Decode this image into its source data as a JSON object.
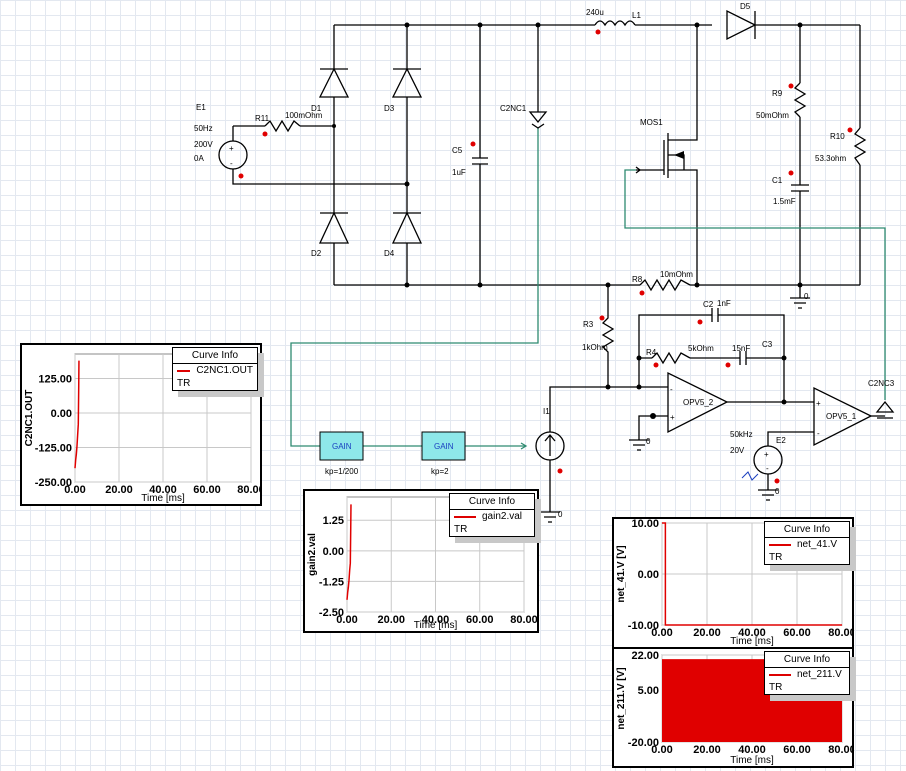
{
  "schematic": {
    "E1": {
      "name": "E1",
      "freq": "50Hz",
      "amp": "200V",
      "phase": "0A"
    },
    "R11": {
      "name": "R11",
      "value": "100mOhm"
    },
    "D1": "D1",
    "D2": "D2",
    "D3": "D3",
    "D4": "D4",
    "D5": "D5",
    "C5": {
      "name": "C5",
      "value": "1uF"
    },
    "C2NC1": {
      "name": "C2NC1"
    },
    "L1": {
      "name": "L1",
      "value": "240u"
    },
    "MOS1": {
      "name": "MOS1"
    },
    "R9": {
      "name": "R9",
      "value": "50mOhm"
    },
    "R10": {
      "name": "R10",
      "value": "53.3ohm"
    },
    "C1": {
      "name": "C1",
      "value": "1.5mF"
    },
    "R8": {
      "name": "R8",
      "value": "10mOhm"
    },
    "ground_label": "0",
    "R3": {
      "name": "R3",
      "value": "1kOhm"
    },
    "C2": {
      "name": "C2",
      "value": "1nF"
    },
    "R4": {
      "name": "R4",
      "value": "5kOhm"
    },
    "C3": {
      "name": "C3",
      "value": "15nF"
    },
    "OPV5_2": "OPV5_2",
    "OPV5_1": "OPV5_1",
    "C2NC3": "C2NC3",
    "E2": {
      "name": "E2",
      "freq": "50kHz",
      "amp": "20V"
    },
    "I1": "I1",
    "gain1": {
      "label": "GAIN",
      "param": "kp=1/200"
    },
    "gain2": {
      "label": "GAIN",
      "param": "kp=2"
    }
  },
  "colors": {
    "wire": "#000000",
    "signal_wire": "#2e8a70",
    "gain_block": "#8ee8ea",
    "probe_dot": "#e00000",
    "curve": "#e00000"
  },
  "chart_data": [
    {
      "type": "line",
      "ylabel": "C2NC1.OUT",
      "xlabel": "Time [ms]",
      "xlim": [
        0,
        80
      ],
      "ylim": [
        -250,
        214
      ],
      "yticks": [
        "125.00",
        "0.00",
        "-125.00",
        "-250.00"
      ],
      "ytick_values": [
        125,
        0,
        -125,
        -250
      ],
      "xticks": [
        "0.00",
        "20.00",
        "40.00",
        "60.00",
        "80.00"
      ],
      "grid": true,
      "legend": {
        "title": "Curve Info",
        "entries": [
          "C2NC1.OUT"
        ],
        "sub": "TR",
        "placement": "top-right"
      },
      "series": [
        {
          "name": "C2NC1.OUT",
          "x": [
            0,
            0.3,
            0.6,
            0.9,
            1.2,
            1.5,
            1.7,
            1.8
          ],
          "y": [
            -200,
            -170,
            -150,
            -120,
            -80,
            -40,
            100,
            190
          ]
        }
      ]
    },
    {
      "type": "line",
      "ylabel": "gain2.val",
      "xlabel": "Time [ms]",
      "xlim": [
        0,
        80
      ],
      "ylim": [
        -2.5,
        2.2
      ],
      "yticks": [
        "1.25",
        "0.00",
        "-1.25",
        "-2.50"
      ],
      "ytick_values": [
        1.25,
        0,
        -1.25,
        -2.5
      ],
      "xticks": [
        "0.00",
        "20.00",
        "40.00",
        "60.00",
        "80.00"
      ],
      "grid": true,
      "legend": {
        "title": "Curve Info",
        "entries": [
          "gain2.val"
        ],
        "sub": "TR",
        "placement": "top-right"
      },
      "series": [
        {
          "name": "gain2.val",
          "x": [
            0,
            0.3,
            0.6,
            0.9,
            1.2,
            1.5,
            1.7,
            1.8
          ],
          "y": [
            -2,
            -1.7,
            -1.5,
            -1.2,
            -0.8,
            -0.5,
            1.0,
            1.9
          ]
        }
      ]
    },
    {
      "type": "line",
      "ylabel": "net_41.V [V]",
      "xlabel": "Time [ms]",
      "xlim": [
        0,
        80
      ],
      "ylim": [
        -10,
        10
      ],
      "yticks": [
        "10.00",
        "0.00",
        "-10.00"
      ],
      "ytick_values": [
        10,
        0,
        -10
      ],
      "xticks": [
        "0.00",
        "20.00",
        "40.00",
        "60.00",
        "80.00"
      ],
      "grid": true,
      "legend": {
        "title": "Curve Info",
        "entries": [
          "net_41.V"
        ],
        "sub": "TR",
        "placement": "top-right"
      },
      "series": [
        {
          "name": "net_41.V",
          "x": [
            0,
            1.5,
            1.5,
            80
          ],
          "y": [
            10,
            10,
            -10,
            -10
          ]
        }
      ]
    },
    {
      "type": "area",
      "ylabel": "net_211.V [V]",
      "xlabel": "Time [ms]",
      "xlim": [
        0,
        80
      ],
      "ylim": [
        -20,
        22
      ],
      "yticks": [
        "22.00",
        "5.00",
        "-20.00"
      ],
      "ytick_values": [
        22,
        5,
        -20
      ],
      "xticks": [
        "0.00",
        "20.00",
        "40.00",
        "60.00",
        "80.00"
      ],
      "grid": true,
      "legend": {
        "title": "Curve Info",
        "entries": [
          "net_211.V"
        ],
        "sub": "TR",
        "placement": "top-right"
      },
      "series": [
        {
          "name": "net_211.V",
          "x": [
            0,
            80
          ],
          "y_max": [
            20,
            20
          ],
          "y_min": [
            -20,
            -20
          ]
        }
      ]
    }
  ]
}
